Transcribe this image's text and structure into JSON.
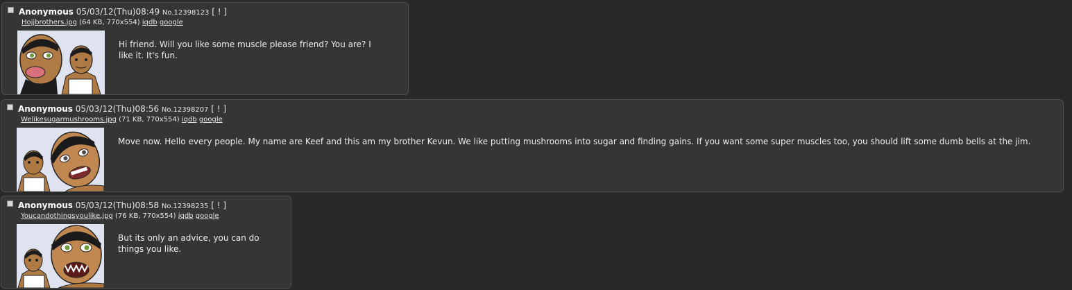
{
  "posts": [
    {
      "name": "Anonymous",
      "datetime": "05/03/12(Thu)08:49",
      "number": "No.12398123",
      "report": "[ ! ]",
      "file_name": "Hojjbrothers.jpg",
      "file_meta": "(64 KB, 770x554)",
      "search_iqdb": "iqdb",
      "search_google": "google",
      "comment": "Hi friend. Will you like some muscle please friend? You are? I like it. It's fun."
    },
    {
      "name": "Anonymous",
      "datetime": "05/03/12(Thu)08:56",
      "number": "No.12398207",
      "report": "[ ! ]",
      "file_name": "Welikesugarmushrooms.jpg",
      "file_meta": "(71 KB, 770x554)",
      "search_iqdb": "iqdb",
      "search_google": "google",
      "comment": "Move now. Hello every people. My name are Keef and this am my brother Kevun. We like putting mushrooms into sugar and finding gains. If you want some super muscles too, you should lift some dumb bells at the jim."
    },
    {
      "name": "Anonymous",
      "datetime": "05/03/12(Thu)08:58",
      "number": "No.12398235",
      "report": "[ ! ]",
      "file_name": "Youcandothingsyoulike.jpg",
      "file_meta": "(76 KB, 770x554)",
      "search_iqdb": "iqdb",
      "search_google": "google",
      "comment": "But its only an advice, you can do things you like."
    }
  ],
  "colors": {
    "page_background": "#292929",
    "post_background": "#353535",
    "post_border": "#4f4f4f",
    "text": "#e6e6e6",
    "thumbnail_background": "#dfe3ef",
    "skin": "#b07a45"
  },
  "icons": {
    "select_checkbox": "checkbox-icon"
  }
}
